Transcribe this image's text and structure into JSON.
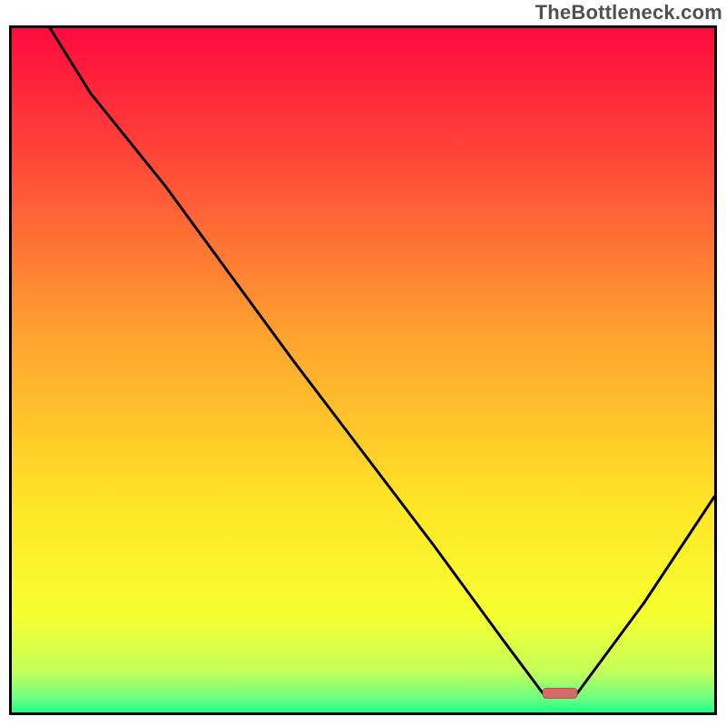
{
  "watermark": "TheBottleneck.com",
  "chart_data": {
    "type": "line",
    "x": [
      0.0,
      0.112,
      0.218,
      0.3,
      0.4,
      0.5,
      0.6,
      0.7,
      0.756,
      0.805,
      0.9,
      1.0
    ],
    "y": [
      1.09,
      0.905,
      0.77,
      0.655,
      0.515,
      0.38,
      0.245,
      0.105,
      0.028,
      0.028,
      0.16,
      0.315
    ],
    "marker": {
      "x_min": 0.756,
      "x_max": 0.805,
      "y": 0.028
    },
    "xlabel": "",
    "ylabel": "",
    "xlim": [
      0,
      1
    ],
    "ylim": [
      0,
      1
    ],
    "title": "",
    "grid": false,
    "legend": false,
    "gradient_stops": [
      {
        "t": 0.0,
        "color": "#ff0a3e"
      },
      {
        "t": 0.2,
        "color": "#ff4a38"
      },
      {
        "t": 0.45,
        "color": "#ffa32f"
      },
      {
        "t": 0.7,
        "color": "#ffe626"
      },
      {
        "t": 0.86,
        "color": "#f6ff30"
      },
      {
        "t": 0.94,
        "color": "#c4ff5a"
      },
      {
        "t": 0.98,
        "color": "#6aff82"
      },
      {
        "t": 1.0,
        "color": "#1bff87"
      }
    ],
    "marker_fill": "#d46a6a",
    "marker_stroke": "#b24f4f",
    "line_color": "#000000",
    "line_width": 3
  }
}
